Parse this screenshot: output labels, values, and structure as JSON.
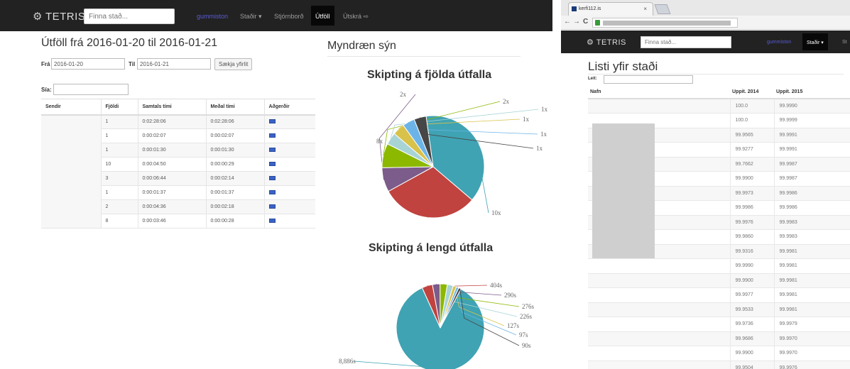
{
  "left": {
    "navbar": {
      "brand": "TETRIS",
      "search_placeholder": "Finna stað...",
      "user": "gummiston",
      "nav_sites": "Staðir ▾",
      "nav_admin": "Stjórnborð",
      "nav_outages": "Útföll",
      "nav_logout": "Útskrá ⇨"
    },
    "filter": {
      "title": "Útföll frá 2016-01-20 til 2016-01-21",
      "from_label": "Frá",
      "from_value": "2016-01-20",
      "to_label": "Til",
      "to_value": "2016-01-21",
      "fetch_button": "Sækja yfirlit",
      "filter_label": "Sía:"
    },
    "table": {
      "headers": [
        "Sendir",
        "Fjöldi",
        "Samtals tími",
        "Meðal tími",
        "Aðgerðir"
      ],
      "rows": [
        {
          "count": "1",
          "total": "0:02:28:06",
          "avg": "0:02:28:06"
        },
        {
          "count": "1",
          "total": "0:00:02:07",
          "avg": "0:00:02:07"
        },
        {
          "count": "1",
          "total": "0:00:01:30",
          "avg": "0:00:01:30"
        },
        {
          "count": "10",
          "total": "0:00:04:50",
          "avg": "0:00:00:29"
        },
        {
          "count": "3",
          "total": "0:00:06:44",
          "avg": "0:00:02:14"
        },
        {
          "count": "1",
          "total": "0:00:01:37",
          "avg": "0:00:01:37"
        },
        {
          "count": "2",
          "total": "0:00:04:36",
          "avg": "0:00:02:18"
        },
        {
          "count": "8",
          "total": "0:00:03:46",
          "avg": "0:00:00:28"
        }
      ]
    },
    "charts": {
      "section_title": "Myndræn sýn",
      "count_title": "Skipting á fjölda útfalla",
      "length_title": "Skipting á lengd útfalla"
    }
  },
  "chart_data": [
    {
      "type": "pie",
      "title": "Skipting á fjölda útfalla",
      "labels": [
        "10x",
        "8x",
        "2x",
        "2x",
        "1x",
        "1x",
        "1x",
        "1x"
      ],
      "values": [
        10,
        8,
        2,
        2,
        1,
        1,
        1,
        1
      ],
      "colors": [
        "#3fa3b3",
        "#c0433f",
        "#7c5c8a",
        "#8cb800",
        "#a8d4d6",
        "#d9c24a",
        "#6cb4e8",
        "#464646"
      ]
    },
    {
      "type": "pie",
      "title": "Skipting á lengd útfalla",
      "labels": [
        "8,886s",
        "404s",
        "290s",
        "276s",
        "226s",
        "127s",
        "97s",
        "90s"
      ],
      "values": [
        8886,
        404,
        290,
        276,
        226,
        127,
        97,
        90
      ],
      "colors": [
        "#3fa3b3",
        "#c0433f",
        "#7c5c8a",
        "#8cb800",
        "#a8d4d6",
        "#d9c24a",
        "#6cb4e8",
        "#464646"
      ]
    }
  ],
  "right": {
    "browser": {
      "tab_title": "kerfi112.is",
      "tab_close": "×",
      "back": "←",
      "forward": "→",
      "reload": "C"
    },
    "navbar": {
      "brand": "TETRIS",
      "search_placeholder": "Finna stað...",
      "user": "gummiston",
      "nav_sites": "Staðir ▾",
      "nav_more": "St"
    },
    "list": {
      "title": "Listi yfir staði",
      "search_label": "Leit:",
      "headers": [
        "Nafn",
        "Uppit. 2014",
        "Uppit. 2015"
      ],
      "rows": [
        {
          "y2014": "100.0",
          "y2015": "99.9990"
        },
        {
          "y2014": "100.0",
          "y2015": "99.9999"
        },
        {
          "y2014": "99.9565",
          "y2015": "99.9991"
        },
        {
          "y2014": "99.9277",
          "y2015": "99.9991"
        },
        {
          "y2014": "99.7662",
          "y2015": "99.9987"
        },
        {
          "y2014": "99.9900",
          "y2015": "99.9987"
        },
        {
          "y2014": "99.9973",
          "y2015": "99.9986"
        },
        {
          "y2014": "99.9986",
          "y2015": "99.9986"
        },
        {
          "y2014": "99.9976",
          "y2015": "99.9983"
        },
        {
          "y2014": "99.9860",
          "y2015": "99.9983"
        },
        {
          "y2014": "99.9316",
          "y2015": "99.9981"
        },
        {
          "y2014": "99.9990",
          "y2015": "99.9981"
        },
        {
          "y2014": "99.9900",
          "y2015": "99.9981"
        },
        {
          "y2014": "99.9977",
          "y2015": "99.9981"
        },
        {
          "y2014": "99.9533",
          "y2015": "99.9981"
        },
        {
          "y2014": "99.9736",
          "y2015": "99.9979"
        },
        {
          "y2014": "99.9686",
          "y2015": "99.9970"
        },
        {
          "y2014": "99.9900",
          "y2015": "99.9970"
        },
        {
          "y2014": "99.9504",
          "y2015": "99.9976"
        }
      ]
    }
  }
}
